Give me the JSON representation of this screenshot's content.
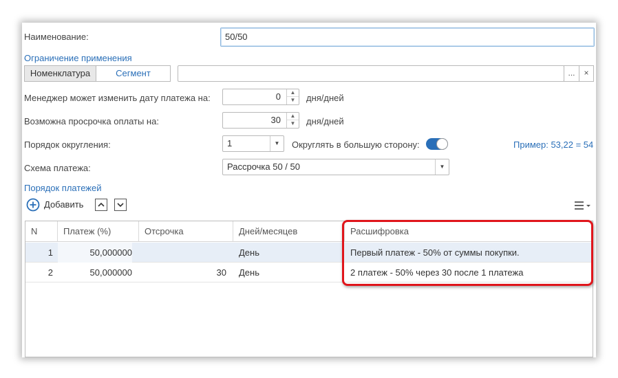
{
  "form": {
    "name_label": "Наименование:",
    "name_value": "50/50",
    "restriction_link": "Ограничение применения",
    "seg_buttons": [
      "Номенклатура",
      "Сегмент"
    ],
    "select_btn": "...",
    "clear_btn": "×",
    "manager_label": "Менеджер может изменить дату платежа на:",
    "manager_value": "0",
    "manager_unit": "дня/дней",
    "delay_label": "Возможна просрочка оплаты на:",
    "delay_value": "30",
    "delay_unit": "дня/дней",
    "rounding_label": "Порядок округления:",
    "rounding_value": "1",
    "round_up_label": "Округлять в большую сторону:",
    "round_up_enabled": true,
    "example": "Пример: 53,22 = 54",
    "scheme_label": "Схема платежа:",
    "scheme_value": "Рассрочка 50 / 50",
    "payments_link": "Порядок платежей",
    "add_button": "Добавить",
    "up_icon": "chevron-up-icon",
    "down_icon": "chevron-down-icon",
    "menu_icon": "hamburger-icon"
  },
  "table": {
    "columns": [
      "N",
      "Платеж (%)",
      "Отсрочка",
      "Дней/месяцев",
      "Расшифровка"
    ],
    "rows": [
      {
        "n": "1",
        "pct": "50,000000",
        "delay": "",
        "unit": "День",
        "desc": "Первый платеж - 50% от суммы покупки."
      },
      {
        "n": "2",
        "pct": "50,000000",
        "delay": "30",
        "unit": "День",
        "desc": "2 платеж - 50% через 30  после 1 платежа"
      }
    ]
  },
  "colors": {
    "accent": "#2a6fb8",
    "highlight": "#e0151b",
    "selected_row": "#e7eef7"
  }
}
